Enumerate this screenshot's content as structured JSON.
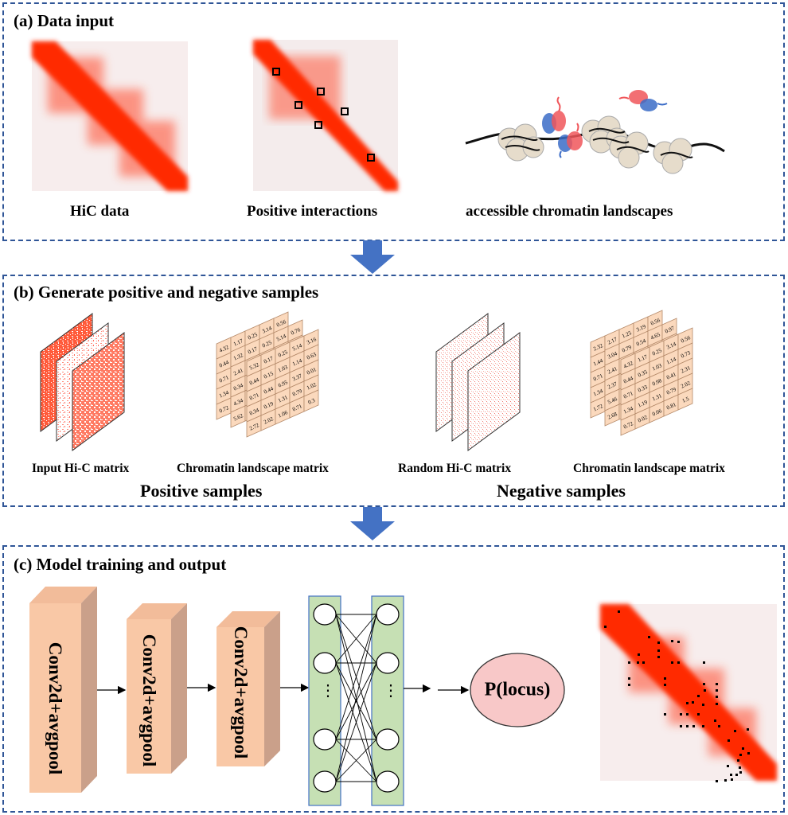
{
  "panels": {
    "a": {
      "title": "(a) Data input",
      "captions": {
        "hic": "HiC data",
        "positive": "Positive interactions",
        "chromatin": "accessible chromatin landscapes"
      }
    },
    "b": {
      "title": "(b) Generate positive and negative samples",
      "captions": {
        "input_hic": "Input Hi-C matrix",
        "chromatin_pos": "Chromatin landscape matrix",
        "random_hic": "Random Hi-C matrix",
        "chromatin_neg": "Chromatin landscape matrix",
        "positive_samples": "Positive samples",
        "negative_samples": "Negative samples"
      },
      "positive_matrix": {
        "back": [
          [
            "4.32",
            "1.17",
            "0.25",
            "3.14",
            "0.56"
          ],
          [
            "0.44",
            "",
            "",
            "",
            ""
          ],
          [
            "0.71",
            "",
            "",
            "",
            ""
          ],
          [
            "1.34",
            "",
            "",
            "",
            ""
          ],
          [
            "0.72",
            "",
            "",
            "",
            ""
          ]
        ],
        "mid": [
          [
            "1.32",
            "0.17",
            "0.25",
            "5.14",
            "0.76"
          ],
          [
            "2.41",
            "",
            "",
            "",
            ""
          ],
          [
            "0.34",
            "",
            "",
            "",
            ""
          ],
          [
            "4.34",
            "",
            "",
            "",
            ""
          ],
          [
            "5.62",
            "",
            "",
            "",
            ""
          ]
        ],
        "front": [
          [
            "5.32",
            "0.17",
            "0.25",
            "5.14",
            "3.16"
          ],
          [
            "0.44",
            "0.15",
            "1.03",
            "1.14",
            "0.63"
          ],
          [
            "0.71",
            "0.44",
            "6.95",
            "3.37",
            "0.01"
          ],
          [
            "0.34",
            "0.19",
            "1.31",
            "0.79",
            "1.02"
          ],
          [
            "2.72",
            "2.02",
            "1.06",
            "0.71",
            "0.3"
          ]
        ]
      },
      "negative_matrix": {
        "back": [
          [
            "2.32",
            "2.17",
            "1.25",
            "3.19",
            "0.56"
          ],
          [
            "1.44",
            "",
            "",
            "",
            ""
          ],
          [
            "0.71",
            "",
            "",
            "",
            ""
          ],
          [
            "1.34",
            "",
            "",
            "",
            ""
          ],
          [
            "1.72",
            "",
            "",
            "",
            ""
          ]
        ],
        "mid": [
          [
            "3.04",
            "0.79",
            "0.54",
            "4.65",
            "0.97"
          ],
          [
            "2.41",
            "",
            "",
            "",
            ""
          ],
          [
            "2.37",
            "",
            "",
            "",
            ""
          ],
          [
            "5.46",
            "",
            "",
            "",
            ""
          ],
          [
            "2.68",
            "",
            "",
            "",
            ""
          ]
        ],
        "front": [
          [
            "4.32",
            "1.17",
            "0.25",
            "3.14",
            "0.56"
          ],
          [
            "0.44",
            "0.35",
            "1.03",
            "1.14",
            "0.73"
          ],
          [
            "0.71",
            "0.33",
            "0.98",
            "0.41",
            "2.31"
          ],
          [
            "1.34",
            "1.19",
            "1.31",
            "0.79",
            "2.02"
          ],
          [
            "0.72",
            "0.02",
            "0.06",
            "0.81",
            "1.5"
          ]
        ]
      }
    },
    "c": {
      "title": "(c) Model training and output",
      "layers": [
        "Conv2d+avgpool",
        "Conv2d+avgpool",
        "Conv2d+avgpool"
      ],
      "ellipsis": "⋮",
      "output": "P(locus)"
    }
  },
  "colors": {
    "border": "#2f5597",
    "arrow": "#4472c4",
    "hic_red": "#ff2a00",
    "matrix_fill": "#fbd9bd",
    "conv_front": "#f9c8a6",
    "conv_side": "#caa08a",
    "conv_top": "#f2bc9a",
    "dense_fill": "#c6e0b4",
    "dense_border": "#4472c4",
    "output_fill": "#f8c8c8"
  }
}
